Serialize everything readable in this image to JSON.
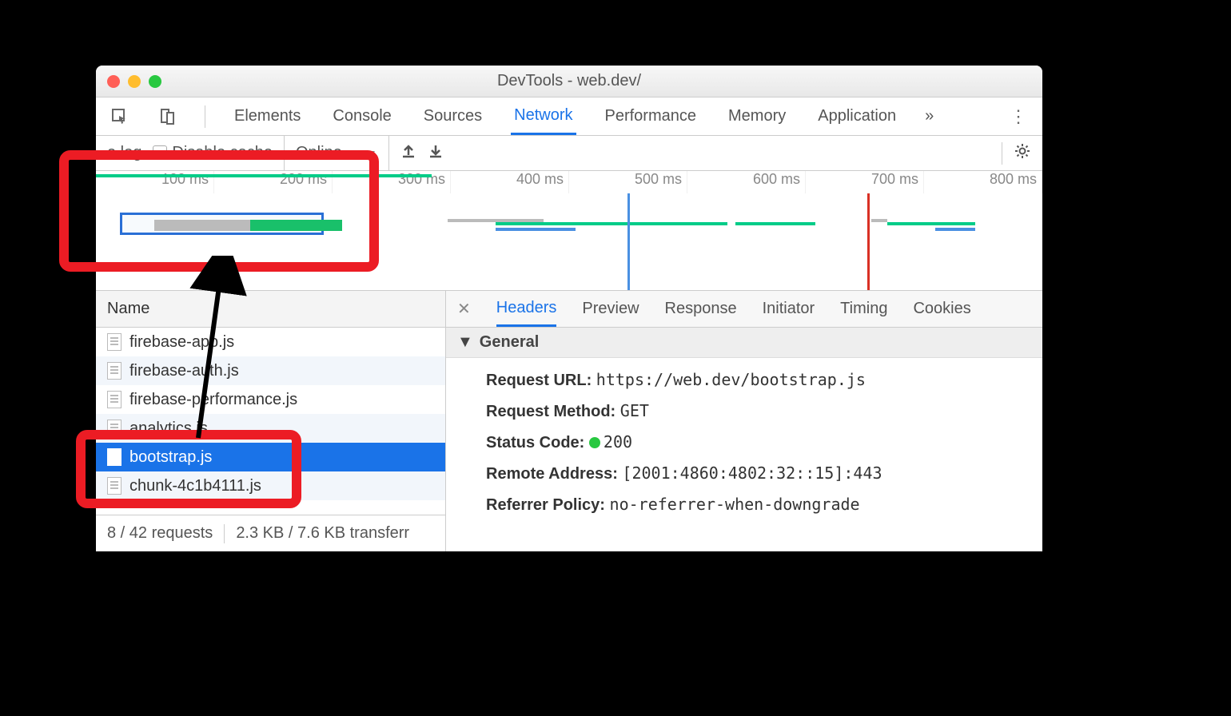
{
  "window": {
    "title": "DevTools - web.dev/"
  },
  "tabs": {
    "items": [
      "Elements",
      "Console",
      "Sources",
      "Network",
      "Performance",
      "Memory",
      "Application"
    ],
    "active": "Network",
    "overflow": "»"
  },
  "toolbar": {
    "preserve_log": "e log",
    "disable_cache": "Disable cache",
    "throttle": "Online"
  },
  "overview": {
    "ticks": [
      "100 ms",
      "200 ms",
      "300 ms",
      "400 ms",
      "500 ms",
      "600 ms",
      "700 ms",
      "800 ms"
    ]
  },
  "name_column": "Name",
  "files": [
    "firebase-app.js",
    "firebase-auth.js",
    "firebase-performance.js",
    "analytics.js",
    "bootstrap.js",
    "chunk-4c1b4111.js"
  ],
  "selected_file": "bootstrap.js",
  "status": {
    "requests": "8 / 42 requests",
    "transfer": "2.3 KB / 7.6 KB transferr"
  },
  "detail": {
    "tabs": [
      "Headers",
      "Preview",
      "Response",
      "Initiator",
      "Timing",
      "Cookies"
    ],
    "active": "Headers",
    "section": "General",
    "kv": {
      "request_url_label": "Request URL:",
      "request_url": "https://web.dev/bootstrap.js",
      "request_method_label": "Request Method:",
      "request_method": "GET",
      "status_code_label": "Status Code:",
      "status_code": "200",
      "remote_addr_label": "Remote Address:",
      "remote_addr": "[2001:4860:4802:32::15]:443",
      "referrer_label": "Referrer Policy:",
      "referrer": "no-referrer-when-downgrade"
    }
  }
}
